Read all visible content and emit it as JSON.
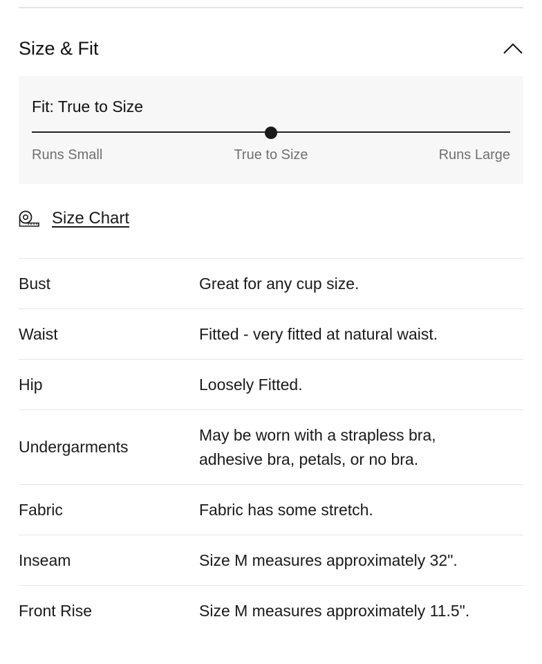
{
  "section": {
    "title": "Size & Fit",
    "expanded": true,
    "chevron_icon": "chevron-up-icon"
  },
  "fit": {
    "label": "Fit: True to Size",
    "scale": {
      "small": "Runs Small",
      "mid": "True to Size",
      "large": "Runs Large"
    },
    "level": 0.5
  },
  "size_chart": {
    "icon": "measuring-tape-icon",
    "label": "Size Chart"
  },
  "specs": [
    {
      "label": "Bust",
      "value": "Great for any cup size."
    },
    {
      "label": "Waist",
      "value": "Fitted - very fitted at natural waist."
    },
    {
      "label": "Hip",
      "value": "Loosely Fitted."
    },
    {
      "label": "Undergarments",
      "value": "May be worn with a strapless bra, adhesive bra, petals, or no bra."
    },
    {
      "label": "Fabric",
      "value": "Fabric has some stretch."
    },
    {
      "label": "Inseam",
      "value": "Size M measures approximately 32\"."
    },
    {
      "label": "Front Rise",
      "value": "Size M measures approximately 11.5\"."
    }
  ]
}
